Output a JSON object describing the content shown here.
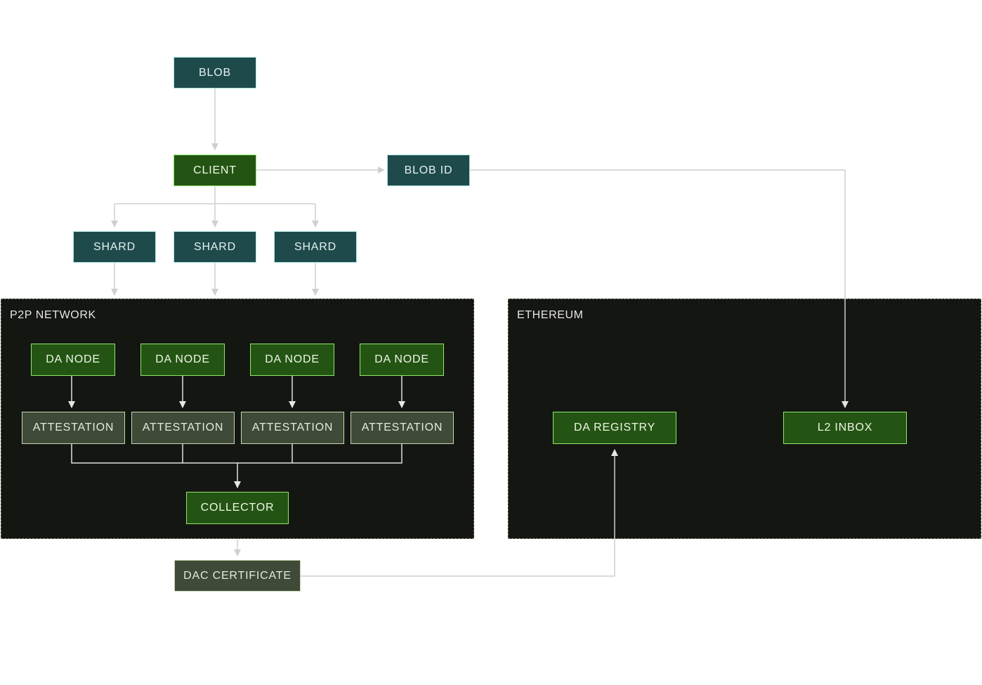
{
  "regions": {
    "p2p": "P2P NETWORK",
    "ethereum": "ETHEREUM"
  },
  "nodes": {
    "blob": "BLOB",
    "client": "CLIENT",
    "blob_id": "BLOB ID",
    "shards": [
      "SHARD",
      "SHARD",
      "SHARD"
    ],
    "da_nodes": [
      "DA NODE",
      "DA NODE",
      "DA NODE",
      "DA NODE"
    ],
    "attestations": [
      "ATTESTATION",
      "ATTESTATION",
      "ATTESTATION",
      "ATTESTATION"
    ],
    "collector": "COLLECTOR",
    "dac_certificate": "DAC CERTIFICATE",
    "da_registry": "DA REGISTRY",
    "l2_inbox": "L2 INBOX"
  },
  "colors": {
    "teal_fill": "#1f4a4c",
    "green_fill": "#245414",
    "olive_fill": "#3f4a38",
    "region_fill": "#141612",
    "connector_light": "#cfcfcf",
    "connector_dark": "#e0e0e0"
  }
}
